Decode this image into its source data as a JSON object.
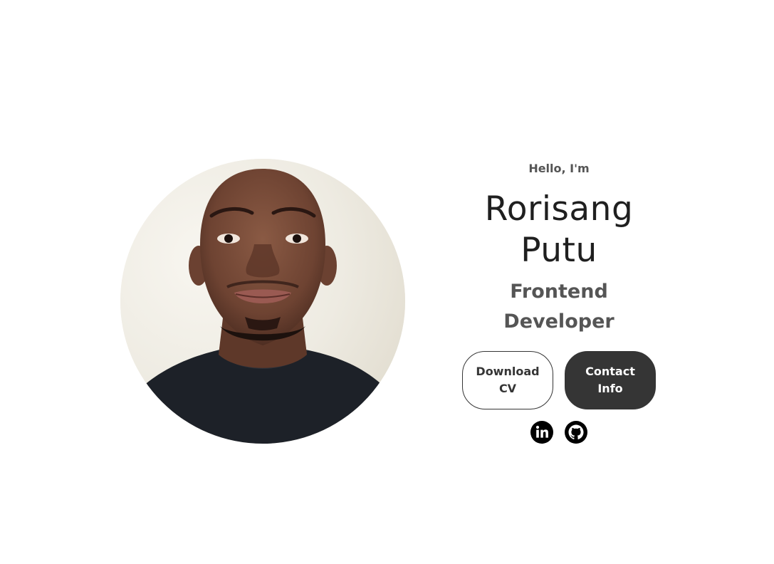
{
  "profile": {
    "image_alt": "Rorisang Putu profile picture"
  },
  "hero": {
    "greeting": "Hello, I'm",
    "name_line1": "Rorisang",
    "name_line2": "Putu",
    "role_line1": "Frontend",
    "role_line2": "Developer"
  },
  "buttons": {
    "download_cv_line1": "Download",
    "download_cv_line2": "CV",
    "contact_info_line1": "Contact",
    "contact_info_line2": "Info"
  },
  "socials": [
    {
      "icon": "linkedin-icon",
      "label": "LinkedIn"
    },
    {
      "icon": "github-icon",
      "label": "GitHub"
    }
  ],
  "colors": {
    "primary_dark": "#353535",
    "heading_text": "#1f1f1f",
    "secondary_text": "#555555",
    "background": "#ffffff"
  }
}
